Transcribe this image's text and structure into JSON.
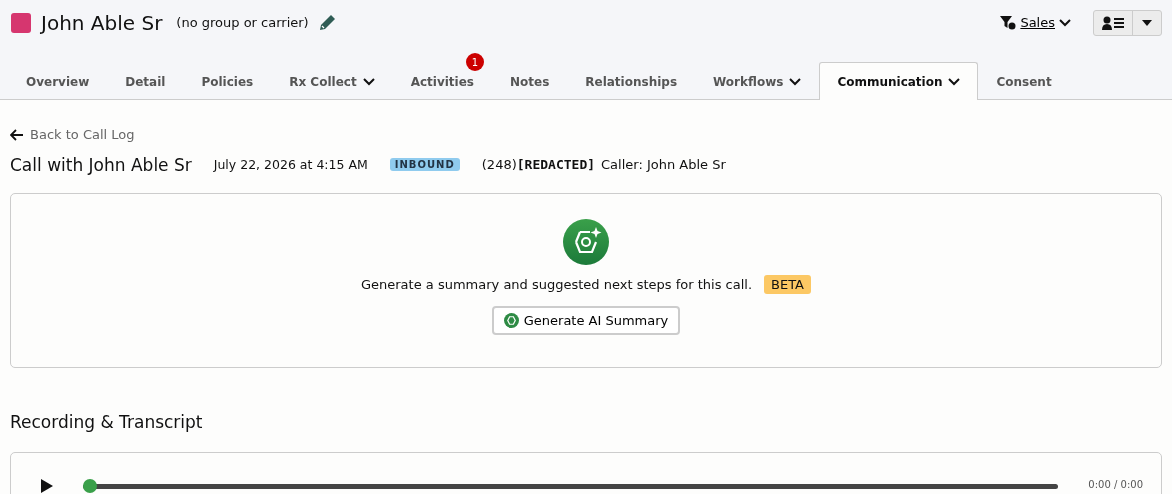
{
  "header": {
    "name": "John Able Sr",
    "group": "(no group or carrier)",
    "filter_label": "Sales"
  },
  "tabs": [
    {
      "label": "Overview",
      "selected": false,
      "dropdown": false
    },
    {
      "label": "Detail",
      "selected": false,
      "dropdown": false
    },
    {
      "label": "Policies",
      "selected": false,
      "dropdown": false
    },
    {
      "label": "Rx Collect",
      "selected": false,
      "dropdown": true
    },
    {
      "label": "Activities",
      "selected": false,
      "dropdown": false,
      "badge": "1"
    },
    {
      "label": "Notes",
      "selected": false,
      "dropdown": false
    },
    {
      "label": "Relationships",
      "selected": false,
      "dropdown": false
    },
    {
      "label": "Workflows",
      "selected": false,
      "dropdown": true
    },
    {
      "label": "Communication",
      "selected": true,
      "dropdown": true
    },
    {
      "label": "Consent",
      "selected": false,
      "dropdown": false
    }
  ],
  "back_link": "Back to Call Log",
  "call": {
    "title": "Call with John Able Sr",
    "datetime": "July 22, 2026 at 4:15 AM",
    "direction": "INBOUND",
    "phone_prefix": "(248)",
    "phone_redacted": "[REDACTED]",
    "caller": "Caller: John Able Sr"
  },
  "ai_card": {
    "prompt": "Generate a summary and suggested next steps for this call.",
    "badge": "BETA",
    "button": "Generate AI Summary"
  },
  "recording": {
    "title": "Recording & Transcript",
    "player": {
      "level": 0.0,
      "time": "0:00 / 0:00"
    }
  }
}
